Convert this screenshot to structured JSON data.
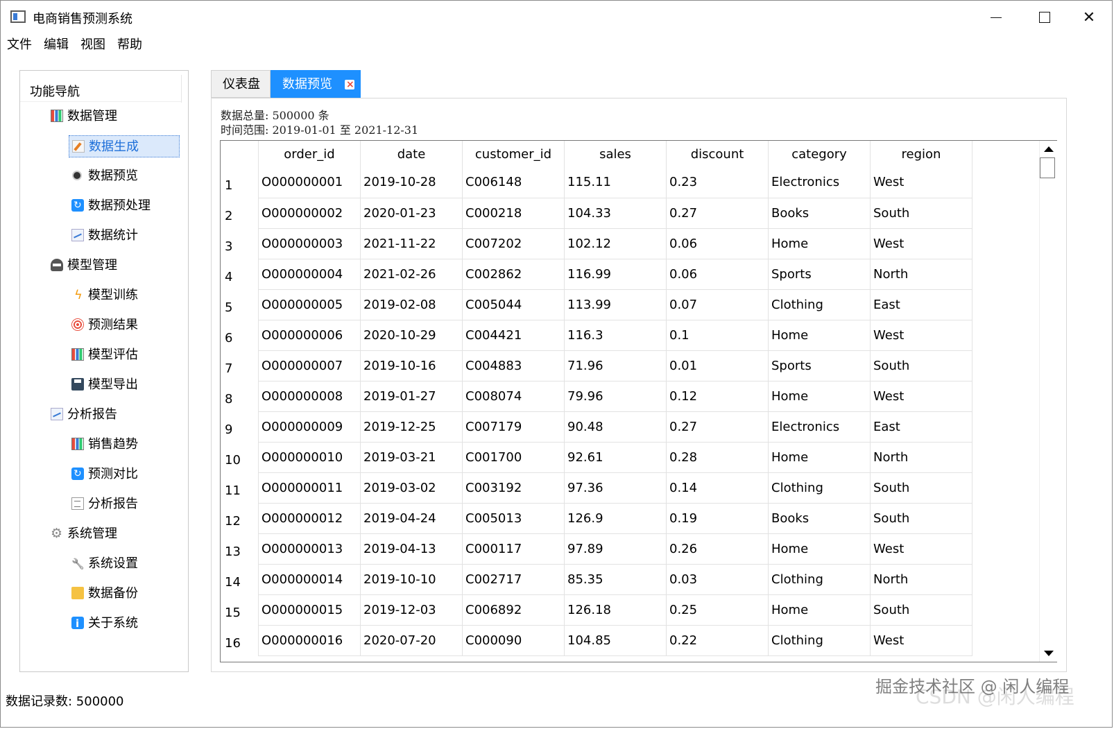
{
  "window": {
    "title": "电商销售预测系统"
  },
  "menu": [
    "文件",
    "编辑",
    "视图",
    "帮助"
  ],
  "sidebar": {
    "header": "功能导航",
    "groups": [
      {
        "label": "数据管理",
        "icon": "bar-chart-icon",
        "items": [
          {
            "label": "数据生成",
            "icon": "edit-icon",
            "selected": true
          },
          {
            "label": "数据预览",
            "icon": "eye-icon"
          },
          {
            "label": "数据预处理",
            "icon": "sync-icon"
          },
          {
            "label": "数据统计",
            "icon": "line-chart-icon"
          }
        ]
      },
      {
        "label": "模型管理",
        "icon": "robot-icon",
        "items": [
          {
            "label": "模型训练",
            "icon": "bolt-icon"
          },
          {
            "label": "预测结果",
            "icon": "target-icon"
          },
          {
            "label": "模型评估",
            "icon": "bar-chart-icon"
          },
          {
            "label": "模型导出",
            "icon": "disk-icon"
          }
        ]
      },
      {
        "label": "分析报告",
        "icon": "line-chart-icon",
        "items": [
          {
            "label": "销售趋势",
            "icon": "bar-chart-icon"
          },
          {
            "label": "预测对比",
            "icon": "sync-icon"
          },
          {
            "label": "分析报告",
            "icon": "document-icon"
          }
        ]
      },
      {
        "label": "系统管理",
        "icon": "gear-icon",
        "items": [
          {
            "label": "系统设置",
            "icon": "wrench-icon"
          },
          {
            "label": "数据备份",
            "icon": "folder-icon"
          },
          {
            "label": "关于系统",
            "icon": "info-icon"
          }
        ]
      }
    ]
  },
  "tabs": [
    {
      "label": "仪表盘",
      "active": false
    },
    {
      "label": "数据预览",
      "active": true
    }
  ],
  "info": {
    "total": "数据总量: 500000 条",
    "range": "时间范围: 2019-01-01 至 2021-12-31"
  },
  "table": {
    "columns": [
      "order_id",
      "date",
      "customer_id",
      "sales",
      "discount",
      "category",
      "region"
    ],
    "rows": [
      [
        "O000000001",
        "2019-10-28",
        "C006148",
        "115.11",
        "0.23",
        "Electronics",
        "West"
      ],
      [
        "O000000002",
        "2020-01-23",
        "C000218",
        "104.33",
        "0.27",
        "Books",
        "South"
      ],
      [
        "O000000003",
        "2021-11-22",
        "C007202",
        "102.12",
        "0.06",
        "Home",
        "West"
      ],
      [
        "O000000004",
        "2021-02-26",
        "C002862",
        "116.99",
        "0.06",
        "Sports",
        "North"
      ],
      [
        "O000000005",
        "2019-02-08",
        "C005044",
        "113.99",
        "0.07",
        "Clothing",
        "East"
      ],
      [
        "O000000006",
        "2020-10-29",
        "C004421",
        "116.3",
        "0.1",
        "Home",
        "West"
      ],
      [
        "O000000007",
        "2019-10-16",
        "C004883",
        "71.96",
        "0.01",
        "Sports",
        "South"
      ],
      [
        "O000000008",
        "2019-01-27",
        "C008074",
        "79.96",
        "0.12",
        "Home",
        "West"
      ],
      [
        "O000000009",
        "2019-12-25",
        "C007179",
        "90.48",
        "0.27",
        "Electronics",
        "East"
      ],
      [
        "O000000010",
        "2019-03-21",
        "C001700",
        "92.61",
        "0.28",
        "Home",
        "North"
      ],
      [
        "O000000011",
        "2019-03-02",
        "C003192",
        "97.36",
        "0.14",
        "Clothing",
        "South"
      ],
      [
        "O000000012",
        "2019-04-24",
        "C005013",
        "126.9",
        "0.19",
        "Books",
        "South"
      ],
      [
        "O000000013",
        "2019-04-13",
        "C000117",
        "97.89",
        "0.26",
        "Home",
        "West"
      ],
      [
        "O000000014",
        "2019-10-10",
        "C002717",
        "85.35",
        "0.03",
        "Clothing",
        "North"
      ],
      [
        "O000000015",
        "2019-12-03",
        "C006892",
        "126.18",
        "0.25",
        "Home",
        "South"
      ],
      [
        "O000000016",
        "2020-07-20",
        "C000090",
        "104.85",
        "0.22",
        "Clothing",
        "West"
      ]
    ]
  },
  "status": "数据记录数: 500000",
  "watermark": "掘金技术社区 @ 闲人编程",
  "watermark2": "CSDN @闲人编程",
  "colors": {
    "accent": "#1e90ff",
    "selected_bg": "#dbe9fb"
  }
}
